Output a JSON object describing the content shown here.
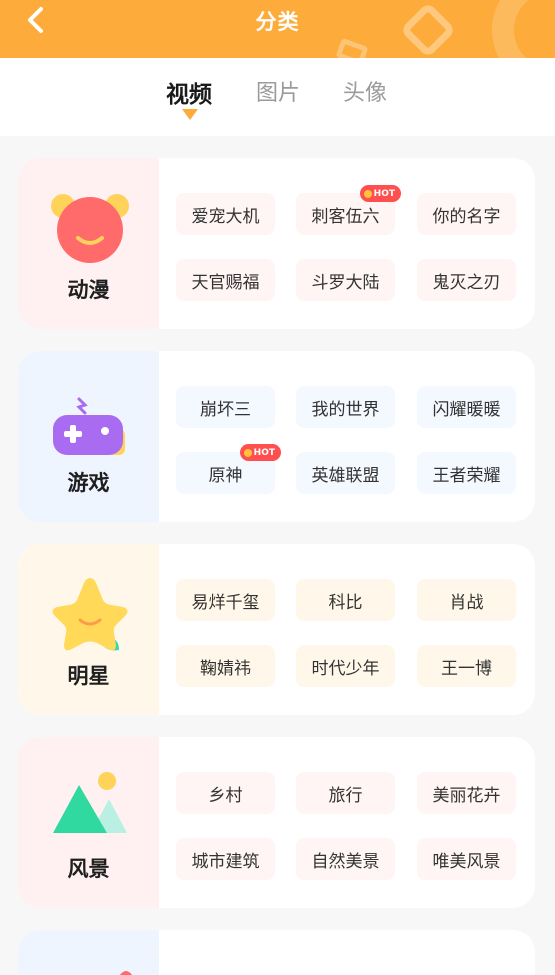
{
  "header": {
    "title": "分类",
    "back_icon": "chevron-left-icon",
    "background": "#fdab3a"
  },
  "tabs": [
    {
      "label": "视频",
      "active": true
    },
    {
      "label": "图片",
      "active": false
    },
    {
      "label": "头像",
      "active": false
    }
  ],
  "categories": [
    {
      "label": "动漫",
      "icon": "bear-face-icon",
      "tags": [
        {
          "label": "爱宠大机",
          "hot": false
        },
        {
          "label": "刺客伍六",
          "hot": true,
          "hot_label": "HOT"
        },
        {
          "label": "你的名字",
          "hot": false
        },
        {
          "label": "天官赐福",
          "hot": false
        },
        {
          "label": "斗罗大陆",
          "hot": false
        },
        {
          "label": "鬼灭之刃",
          "hot": false
        }
      ]
    },
    {
      "label": "游戏",
      "icon": "gamepad-icon",
      "tags": [
        {
          "label": "崩坏三",
          "hot": false
        },
        {
          "label": "我的世界",
          "hot": false
        },
        {
          "label": "闪耀暖暖",
          "hot": false
        },
        {
          "label": "原神",
          "hot": true,
          "hot_label": "HOT"
        },
        {
          "label": "英雄联盟",
          "hot": false
        },
        {
          "label": "王者荣耀",
          "hot": false
        }
      ]
    },
    {
      "label": "明星",
      "icon": "star-icon",
      "tags": [
        {
          "label": "易烊千玺",
          "hot": false
        },
        {
          "label": "科比",
          "hot": false
        },
        {
          "label": "肖战",
          "hot": false
        },
        {
          "label": "鞠婧祎",
          "hot": false
        },
        {
          "label": "时代少年",
          "hot": false
        },
        {
          "label": "王一博",
          "hot": false
        }
      ]
    },
    {
      "label": "风景",
      "icon": "mountain-sun-icon",
      "tags": [
        {
          "label": "乡村",
          "hot": false
        },
        {
          "label": "旅行",
          "hot": false
        },
        {
          "label": "美丽花卉",
          "hot": false
        },
        {
          "label": "城市建筑",
          "hot": false
        },
        {
          "label": "自然美景",
          "hot": false
        },
        {
          "label": "唯美风景",
          "hot": false
        }
      ]
    }
  ],
  "colors": {
    "accent": "#fdab3a",
    "hot_badge": "#ff4f4f"
  }
}
